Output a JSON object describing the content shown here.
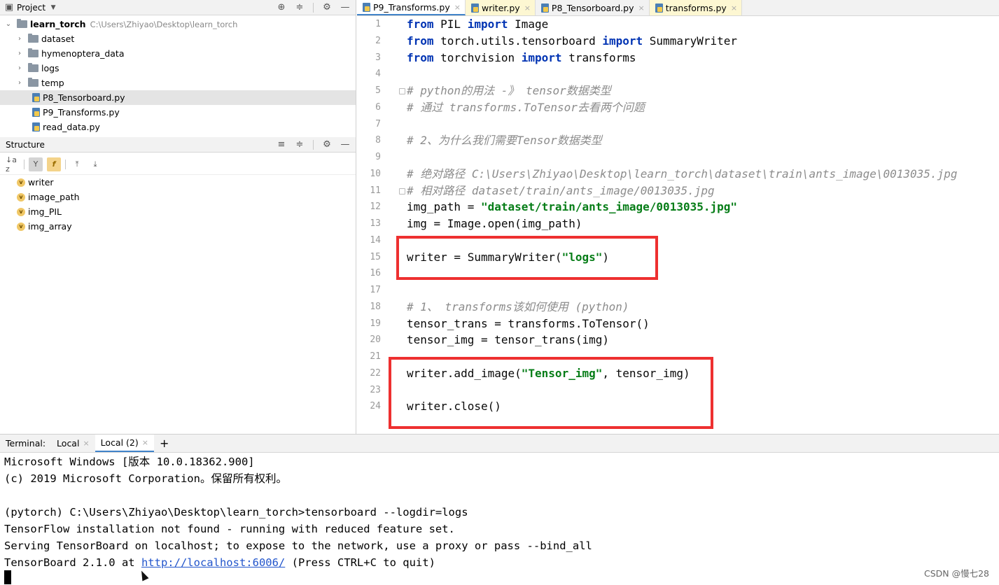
{
  "project_panel": {
    "title": "Project",
    "tree": [
      {
        "label": "learn_torch",
        "hint": "C:\\Users\\Zhiyao\\Desktop\\learn_torch",
        "type": "root"
      },
      {
        "label": "dataset",
        "type": "folder"
      },
      {
        "label": "hymenoptera_data",
        "type": "folder"
      },
      {
        "label": "logs",
        "type": "folder"
      },
      {
        "label": "temp",
        "type": "folder"
      },
      {
        "label": "P8_Tensorboard.py",
        "type": "file",
        "selected": true
      },
      {
        "label": "P9_Transforms.py",
        "type": "file"
      },
      {
        "label": "read_data.py",
        "type": "file"
      }
    ]
  },
  "structure_panel": {
    "title": "Structure",
    "items": [
      "writer",
      "image_path",
      "img_PIL",
      "img_array"
    ],
    "badge": "v",
    "sort_label": "↓a z"
  },
  "editor": {
    "tabs": [
      {
        "label": "P9_Transforms.py",
        "active": true
      },
      {
        "label": "writer.py",
        "yellow": true
      },
      {
        "label": "P8_Tensorboard.py"
      },
      {
        "label": "transforms.py",
        "yellow": true
      }
    ],
    "line_numbers": [
      "1",
      "2",
      "3",
      "4",
      "5",
      "6",
      "7",
      "8",
      "9",
      "10",
      "11",
      "12",
      "13",
      "14",
      "15",
      "16",
      "17",
      "18",
      "19",
      "20",
      "21",
      "22",
      "23",
      "24"
    ],
    "code": {
      "l1_kw1": "from",
      "l1_a": " PIL ",
      "l1_kw2": "import",
      "l1_b": " Image",
      "l2_kw1": "from",
      "l2_a": " torch.utils.tensorboard ",
      "l2_kw2": "import",
      "l2_b": " SummaryWriter",
      "l3_kw1": "from",
      "l3_a": " torchvision ",
      "l3_kw2": "import",
      "l3_b": " transforms",
      "l5": "# python的用法 -》 tensor数据类型",
      "l6": "# 通过 transforms.ToTensor去看两个问题",
      "l8": "# 2、为什么我们需要Tensor数据类型",
      "l10": "# 绝对路径 C:\\Users\\Zhiyao\\Desktop\\learn_torch\\dataset\\train\\ants_image\\0013035.jpg",
      "l11": "# 相对路径 dataset/train/ants_image/0013035.jpg",
      "l12_a": "img_path = ",
      "l12_s": "\"dataset/train/ants_image/0013035.jpg\"",
      "l13": "img = Image.open(img_path)",
      "l15_a": "writer = SummaryWriter(",
      "l15_s": "\"logs\"",
      "l15_b": ")",
      "l18": "# 1、 transforms该如何使用 (python)",
      "l19": "tensor_trans = transforms.ToTensor()",
      "l20": "tensor_img = tensor_trans(img)",
      "l22_a": "writer.add_image(",
      "l22_s": "\"Tensor_img\"",
      "l22_b": ", tensor_img)",
      "l24": "writer.close()"
    }
  },
  "terminal": {
    "label": "Terminal:",
    "tabs": [
      {
        "label": "Local"
      },
      {
        "label": "Local (2)",
        "active": true
      }
    ],
    "add": "+",
    "lines": {
      "t1": "Microsoft Windows [版本 10.0.18362.900]",
      "t2": "(c) 2019 Microsoft Corporation。保留所有权利。",
      "t4": "(pytorch) C:\\Users\\Zhiyao\\Desktop\\learn_torch>tensorboard --logdir=logs",
      "t5": "TensorFlow installation not found - running with reduced feature set.",
      "t6": "Serving TensorBoard on localhost; to expose to the network, use a proxy or pass --bind_all",
      "t7_a": "TensorBoard 2.1.0 at ",
      "t7_link": "http://localhost:6006/",
      "t7_b": " (Press CTRL+C to quit)"
    }
  },
  "watermark": "CSDN @慢七28",
  "colors": {
    "highlight_box": "#ee3030",
    "keyword": "#0033b3",
    "string": "#067d17",
    "comment": "#8c8c8c",
    "accent": "#4083c9"
  }
}
